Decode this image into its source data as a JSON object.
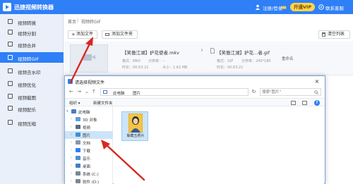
{
  "app": {
    "title": "迅捷视频转换器",
    "login_label": "注册/登录",
    "vip_label": "开通VIP",
    "support_label": "联系客服",
    "accent": "#2f7ff7"
  },
  "sidebar": {
    "items": [
      {
        "label": "视频转换",
        "icon": "convert-icon",
        "active": false
      },
      {
        "label": "视频分割",
        "icon": "split-icon",
        "active": false
      },
      {
        "label": "视频合并",
        "icon": "merge-icon",
        "active": false
      },
      {
        "label": "视频转GIF",
        "icon": "gif-icon",
        "active": true
      },
      {
        "label": "视频去水印",
        "icon": "watermark-icon",
        "active": false
      },
      {
        "label": "视频优化",
        "icon": "optimize-icon",
        "active": false
      },
      {
        "label": "视频截图",
        "icon": "screenshot-icon",
        "active": false
      },
      {
        "label": "视频配乐",
        "icon": "music-icon",
        "active": false
      },
      {
        "label": "视频压缩",
        "icon": "compress-icon",
        "active": false
      }
    ]
  },
  "breadcrumb": {
    "home": "首页",
    "separator": "|",
    "current": "视频转GIF"
  },
  "toolbar": {
    "add_file": "添加文件",
    "add_folder": "添加文件夹",
    "clear_list": "清空列表"
  },
  "file_item": {
    "source_name": "【笑傲江湖】护花使者.mkv",
    "source_format": "格式：MKV",
    "source_res": "分辨率：--",
    "source_size": "大小：1.62 MB",
    "source_duration": "时长：00:03:21",
    "target_name": "【笑傲江湖】护花...者.gif",
    "target_format": "格式：GIF",
    "target_res": "分辨率：240*180",
    "target_duration": "时长：00:03:21",
    "rename_label": "重命名"
  },
  "dialog": {
    "title": "请选择视频文件",
    "close_label": "×",
    "address": [
      "此电脑",
      "图片"
    ],
    "search_placeholder": "搜索\"图片\"",
    "organize_label": "组织 ▾",
    "new_folder_label": "新建文件夹",
    "help_label": "?",
    "tree": [
      {
        "label": "此电脑",
        "icon": "pc-icon",
        "expander": "▾",
        "selected": false
      },
      {
        "label": "3D 对象",
        "icon": "3d-objects-icon",
        "expander": "›",
        "selected": false
      },
      {
        "label": "视频",
        "icon": "videos-folder-icon",
        "expander": "›",
        "selected": false
      },
      {
        "label": "图片",
        "icon": "pictures-folder-icon",
        "expander": "›",
        "selected": true
      },
      {
        "label": "文档",
        "icon": "documents-folder-icon",
        "expander": "›",
        "selected": false
      },
      {
        "label": "下载",
        "icon": "downloads-folder-icon",
        "expander": "›",
        "selected": false
      },
      {
        "label": "音乐",
        "icon": "music-folder-icon",
        "expander": "›",
        "selected": false
      },
      {
        "label": "桌面",
        "icon": "desktop-folder-icon",
        "expander": "›",
        "selected": false
      },
      {
        "label": "系统 (C:)",
        "icon": "drive-c-icon",
        "expander": "›",
        "selected": false
      },
      {
        "label": "软件 (D:)",
        "icon": "drive-d-icon",
        "expander": "›",
        "selected": false
      }
    ],
    "files": [
      {
        "label": "躲藏玉照片",
        "icon": "image-file-icon"
      }
    ]
  }
}
